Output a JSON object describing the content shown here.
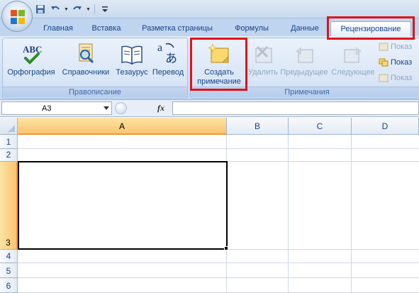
{
  "tabs": [
    "Главная",
    "Вставка",
    "Разметка страницы",
    "Формулы",
    "Данные",
    "Рецензирование"
  ],
  "active_tab": "Рецензирование",
  "ribbon": {
    "proofing": {
      "label": "Правописание",
      "spelling": "Орфография",
      "research": "Справочники",
      "thesaurus": "Тезаурус",
      "translate": "Перевод",
      "abc_glyph": "ABC"
    },
    "comments": {
      "label": "Примечания",
      "new_comment_line1": "Создать",
      "new_comment_line2": "примечание",
      "delete": "Удалить",
      "previous": "Предыдущее",
      "next": "Следующее",
      "show1": "Показ",
      "show2": "Показ",
      "show3": "Показ"
    }
  },
  "formula_bar": {
    "name_box": "A3",
    "fx": "fx",
    "formula": ""
  },
  "grid": {
    "columns": [
      "A",
      "B",
      "C",
      "D"
    ],
    "rows": [
      "1",
      "2",
      "3",
      "4",
      "5",
      "6"
    ],
    "selected_cell": "A3"
  },
  "colors": {
    "highlight_red": "#e0131b",
    "selected_header": "#f9c670",
    "ribbon_text": "#15428b"
  }
}
